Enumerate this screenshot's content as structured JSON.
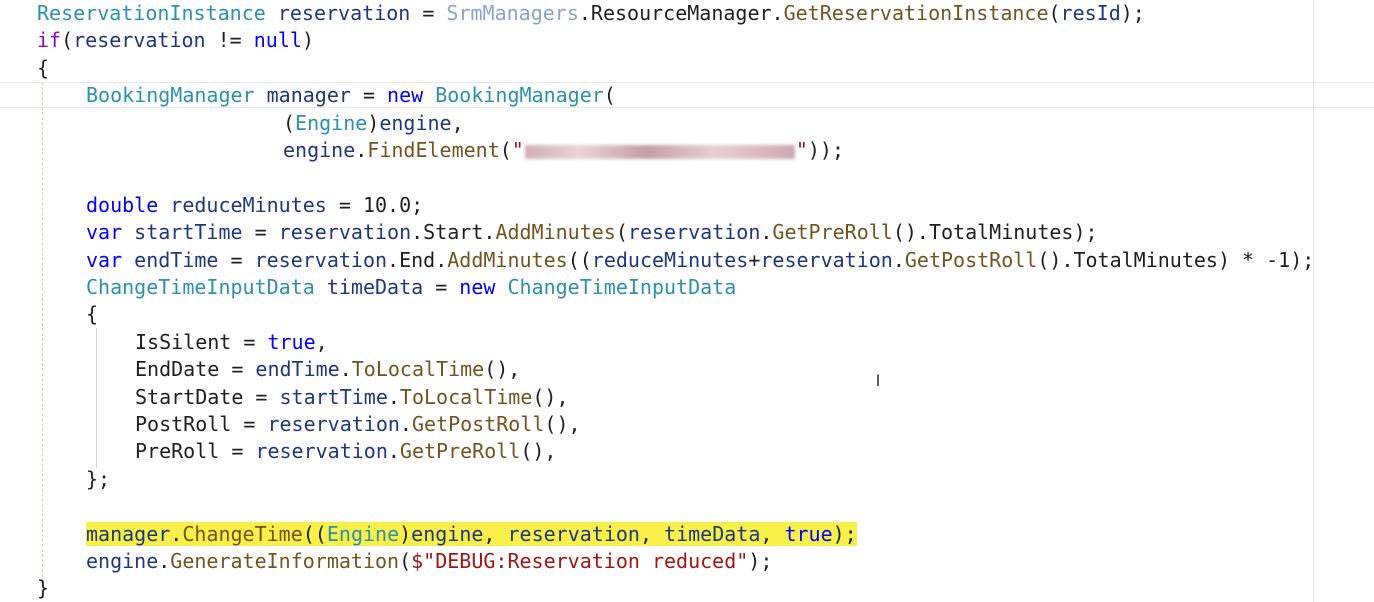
{
  "colors": {
    "plain": "#1f1f1f",
    "type": "#2b91af",
    "keyword": "#0000ff",
    "control": "#8f08c4",
    "variable": "#1f377f",
    "method": "#74531f",
    "string": "#a31515",
    "highlight": "#f8f048"
  },
  "cursor_icon": "i-beam-cursor",
  "code_lines": [
    {
      "indent": 37,
      "highlight": false,
      "tokens": [
        {
          "t": "ReservationInstance",
          "c": "type"
        },
        {
          "t": " ",
          "c": "plain"
        },
        {
          "t": "reservation",
          "c": "var"
        },
        {
          "t": " = ",
          "c": "plain"
        },
        {
          "t": "SrmManagers",
          "c": "mgr"
        },
        {
          "t": ".",
          "c": "plain"
        },
        {
          "t": "ResourceManager",
          "c": "plain"
        },
        {
          "t": ".",
          "c": "plain"
        },
        {
          "t": "GetReservationInstance",
          "c": "meth"
        },
        {
          "t": "(",
          "c": "plain"
        },
        {
          "t": "resId",
          "c": "var"
        },
        {
          "t": ");",
          "c": "plain"
        }
      ]
    },
    {
      "indent": 37,
      "highlight": false,
      "tokens": [
        {
          "t": "if",
          "c": "ctl"
        },
        {
          "t": "(",
          "c": "plain"
        },
        {
          "t": "reservation",
          "c": "var"
        },
        {
          "t": " != ",
          "c": "plain"
        },
        {
          "t": "null",
          "c": "kw"
        },
        {
          "t": ")",
          "c": "plain"
        }
      ]
    },
    {
      "indent": 37,
      "highlight": false,
      "tokens": [
        {
          "t": "{",
          "c": "plain"
        }
      ]
    },
    {
      "indent": 86,
      "highlight": false,
      "tokens": [
        {
          "t": "BookingManager",
          "c": "type"
        },
        {
          "t": " ",
          "c": "plain"
        },
        {
          "t": "manager",
          "c": "var"
        },
        {
          "t": " = ",
          "c": "plain"
        },
        {
          "t": "new",
          "c": "kw"
        },
        {
          "t": " ",
          "c": "plain"
        },
        {
          "t": "BookingManager",
          "c": "type"
        },
        {
          "t": "(",
          "c": "plain"
        }
      ]
    },
    {
      "indent": 283,
      "highlight": false,
      "tokens": [
        {
          "t": "(",
          "c": "plain"
        },
        {
          "t": "Engine",
          "c": "type"
        },
        {
          "t": ")",
          "c": "plain"
        },
        {
          "t": "engine",
          "c": "param"
        },
        {
          "t": ",",
          "c": "plain"
        }
      ]
    },
    {
      "indent": 283,
      "highlight": false,
      "tokens": [
        {
          "t": "engine",
          "c": "param"
        },
        {
          "t": ".",
          "c": "plain"
        },
        {
          "t": "FindElement",
          "c": "meth"
        },
        {
          "t": "(",
          "c": "plain"
        },
        {
          "t": "\"",
          "c": "str"
        },
        {
          "t": "",
          "c": "blur",
          "w": 270
        },
        {
          "t": "\"",
          "c": "str"
        },
        {
          "t": "));",
          "c": "plain"
        }
      ]
    },
    {
      "indent": 86,
      "highlight": false,
      "tokens": []
    },
    {
      "indent": 86,
      "highlight": false,
      "tokens": [
        {
          "t": "double",
          "c": "kw"
        },
        {
          "t": " ",
          "c": "plain"
        },
        {
          "t": "reduceMinutes",
          "c": "var"
        },
        {
          "t": " = ",
          "c": "plain"
        },
        {
          "t": "10.0",
          "c": "num"
        },
        {
          "t": ";",
          "c": "plain"
        }
      ]
    },
    {
      "indent": 86,
      "highlight": false,
      "tokens": [
        {
          "t": "var",
          "c": "kw"
        },
        {
          "t": " ",
          "c": "plain"
        },
        {
          "t": "startTime",
          "c": "var"
        },
        {
          "t": " = ",
          "c": "plain"
        },
        {
          "t": "reservation",
          "c": "var"
        },
        {
          "t": ".",
          "c": "plain"
        },
        {
          "t": "Start",
          "c": "plain"
        },
        {
          "t": ".",
          "c": "plain"
        },
        {
          "t": "AddMinutes",
          "c": "meth"
        },
        {
          "t": "(",
          "c": "plain"
        },
        {
          "t": "reservation",
          "c": "var"
        },
        {
          "t": ".",
          "c": "plain"
        },
        {
          "t": "GetPreRoll",
          "c": "meth"
        },
        {
          "t": "().",
          "c": "plain"
        },
        {
          "t": "TotalMinutes",
          "c": "plain"
        },
        {
          "t": ");",
          "c": "plain"
        }
      ]
    },
    {
      "indent": 86,
      "highlight": false,
      "tokens": [
        {
          "t": "var",
          "c": "kw"
        },
        {
          "t": " ",
          "c": "plain"
        },
        {
          "t": "endTime",
          "c": "var"
        },
        {
          "t": " = ",
          "c": "plain"
        },
        {
          "t": "reservation",
          "c": "var"
        },
        {
          "t": ".",
          "c": "plain"
        },
        {
          "t": "End",
          "c": "plain"
        },
        {
          "t": ".",
          "c": "plain"
        },
        {
          "t": "AddMinutes",
          "c": "meth"
        },
        {
          "t": "((",
          "c": "plain"
        },
        {
          "t": "reduceMinutes",
          "c": "var"
        },
        {
          "t": "+",
          "c": "plain"
        },
        {
          "t": "reservation",
          "c": "var"
        },
        {
          "t": ".",
          "c": "plain"
        },
        {
          "t": "GetPostRoll",
          "c": "meth"
        },
        {
          "t": "().",
          "c": "plain"
        },
        {
          "t": "TotalMinutes",
          "c": "plain"
        },
        {
          "t": ") * -1);",
          "c": "plain"
        }
      ]
    },
    {
      "indent": 86,
      "highlight": false,
      "tokens": [
        {
          "t": "ChangeTimeInputData",
          "c": "type"
        },
        {
          "t": " ",
          "c": "plain"
        },
        {
          "t": "timeData",
          "c": "var"
        },
        {
          "t": " = ",
          "c": "plain"
        },
        {
          "t": "new",
          "c": "kw"
        },
        {
          "t": " ",
          "c": "plain"
        },
        {
          "t": "ChangeTimeInputData",
          "c": "type"
        }
      ]
    },
    {
      "indent": 86,
      "highlight": false,
      "tokens": [
        {
          "t": "{",
          "c": "plain"
        }
      ]
    },
    {
      "indent": 135,
      "highlight": false,
      "tokens": [
        {
          "t": "IsSilent",
          "c": "plain"
        },
        {
          "t": " = ",
          "c": "plain"
        },
        {
          "t": "true",
          "c": "kw"
        },
        {
          "t": ",",
          "c": "plain"
        }
      ]
    },
    {
      "indent": 135,
      "highlight": false,
      "tokens": [
        {
          "t": "EndDate",
          "c": "plain"
        },
        {
          "t": " = ",
          "c": "plain"
        },
        {
          "t": "endTime",
          "c": "var"
        },
        {
          "t": ".",
          "c": "plain"
        },
        {
          "t": "ToLocalTime",
          "c": "meth"
        },
        {
          "t": "(),",
          "c": "plain"
        }
      ]
    },
    {
      "indent": 135,
      "highlight": false,
      "tokens": [
        {
          "t": "StartDate",
          "c": "plain"
        },
        {
          "t": " = ",
          "c": "plain"
        },
        {
          "t": "startTime",
          "c": "var"
        },
        {
          "t": ".",
          "c": "plain"
        },
        {
          "t": "ToLocalTime",
          "c": "meth"
        },
        {
          "t": "(),",
          "c": "plain"
        }
      ]
    },
    {
      "indent": 135,
      "highlight": false,
      "tokens": [
        {
          "t": "PostRoll",
          "c": "plain"
        },
        {
          "t": " = ",
          "c": "plain"
        },
        {
          "t": "reservation",
          "c": "var"
        },
        {
          "t": ".",
          "c": "plain"
        },
        {
          "t": "GetPostRoll",
          "c": "meth"
        },
        {
          "t": "(),",
          "c": "plain"
        }
      ]
    },
    {
      "indent": 135,
      "highlight": false,
      "tokens": [
        {
          "t": "PreRoll",
          "c": "plain"
        },
        {
          "t": " = ",
          "c": "plain"
        },
        {
          "t": "reservation",
          "c": "var"
        },
        {
          "t": ".",
          "c": "plain"
        },
        {
          "t": "GetPreRoll",
          "c": "meth"
        },
        {
          "t": "(),",
          "c": "plain"
        }
      ]
    },
    {
      "indent": 86,
      "highlight": false,
      "tokens": [
        {
          "t": "};",
          "c": "plain"
        }
      ]
    },
    {
      "indent": 86,
      "highlight": false,
      "tokens": []
    },
    {
      "indent": 86,
      "highlight": true,
      "tokens": [
        {
          "t": "manager",
          "c": "var"
        },
        {
          "t": ".",
          "c": "plain"
        },
        {
          "t": "ChangeTime",
          "c": "meth"
        },
        {
          "t": "((",
          "c": "plain"
        },
        {
          "t": "Engine",
          "c": "type"
        },
        {
          "t": ")",
          "c": "plain"
        },
        {
          "t": "engine",
          "c": "param"
        },
        {
          "t": ", ",
          "c": "plain"
        },
        {
          "t": "reservation",
          "c": "var"
        },
        {
          "t": ", ",
          "c": "plain"
        },
        {
          "t": "timeData",
          "c": "var"
        },
        {
          "t": ", ",
          "c": "plain"
        },
        {
          "t": "true",
          "c": "kw"
        },
        {
          "t": ");",
          "c": "plain"
        }
      ]
    },
    {
      "indent": 86,
      "highlight": false,
      "tokens": [
        {
          "t": "engine",
          "c": "param"
        },
        {
          "t": ".",
          "c": "plain"
        },
        {
          "t": "GenerateInformation",
          "c": "meth"
        },
        {
          "t": "(",
          "c": "plain"
        },
        {
          "t": "$\"DEBUG:Reservation reduced\"",
          "c": "str"
        },
        {
          "t": ");",
          "c": "plain"
        }
      ]
    },
    {
      "indent": 37,
      "highlight": false,
      "tokens": [
        {
          "t": "}",
          "c": "plain"
        }
      ]
    }
  ]
}
